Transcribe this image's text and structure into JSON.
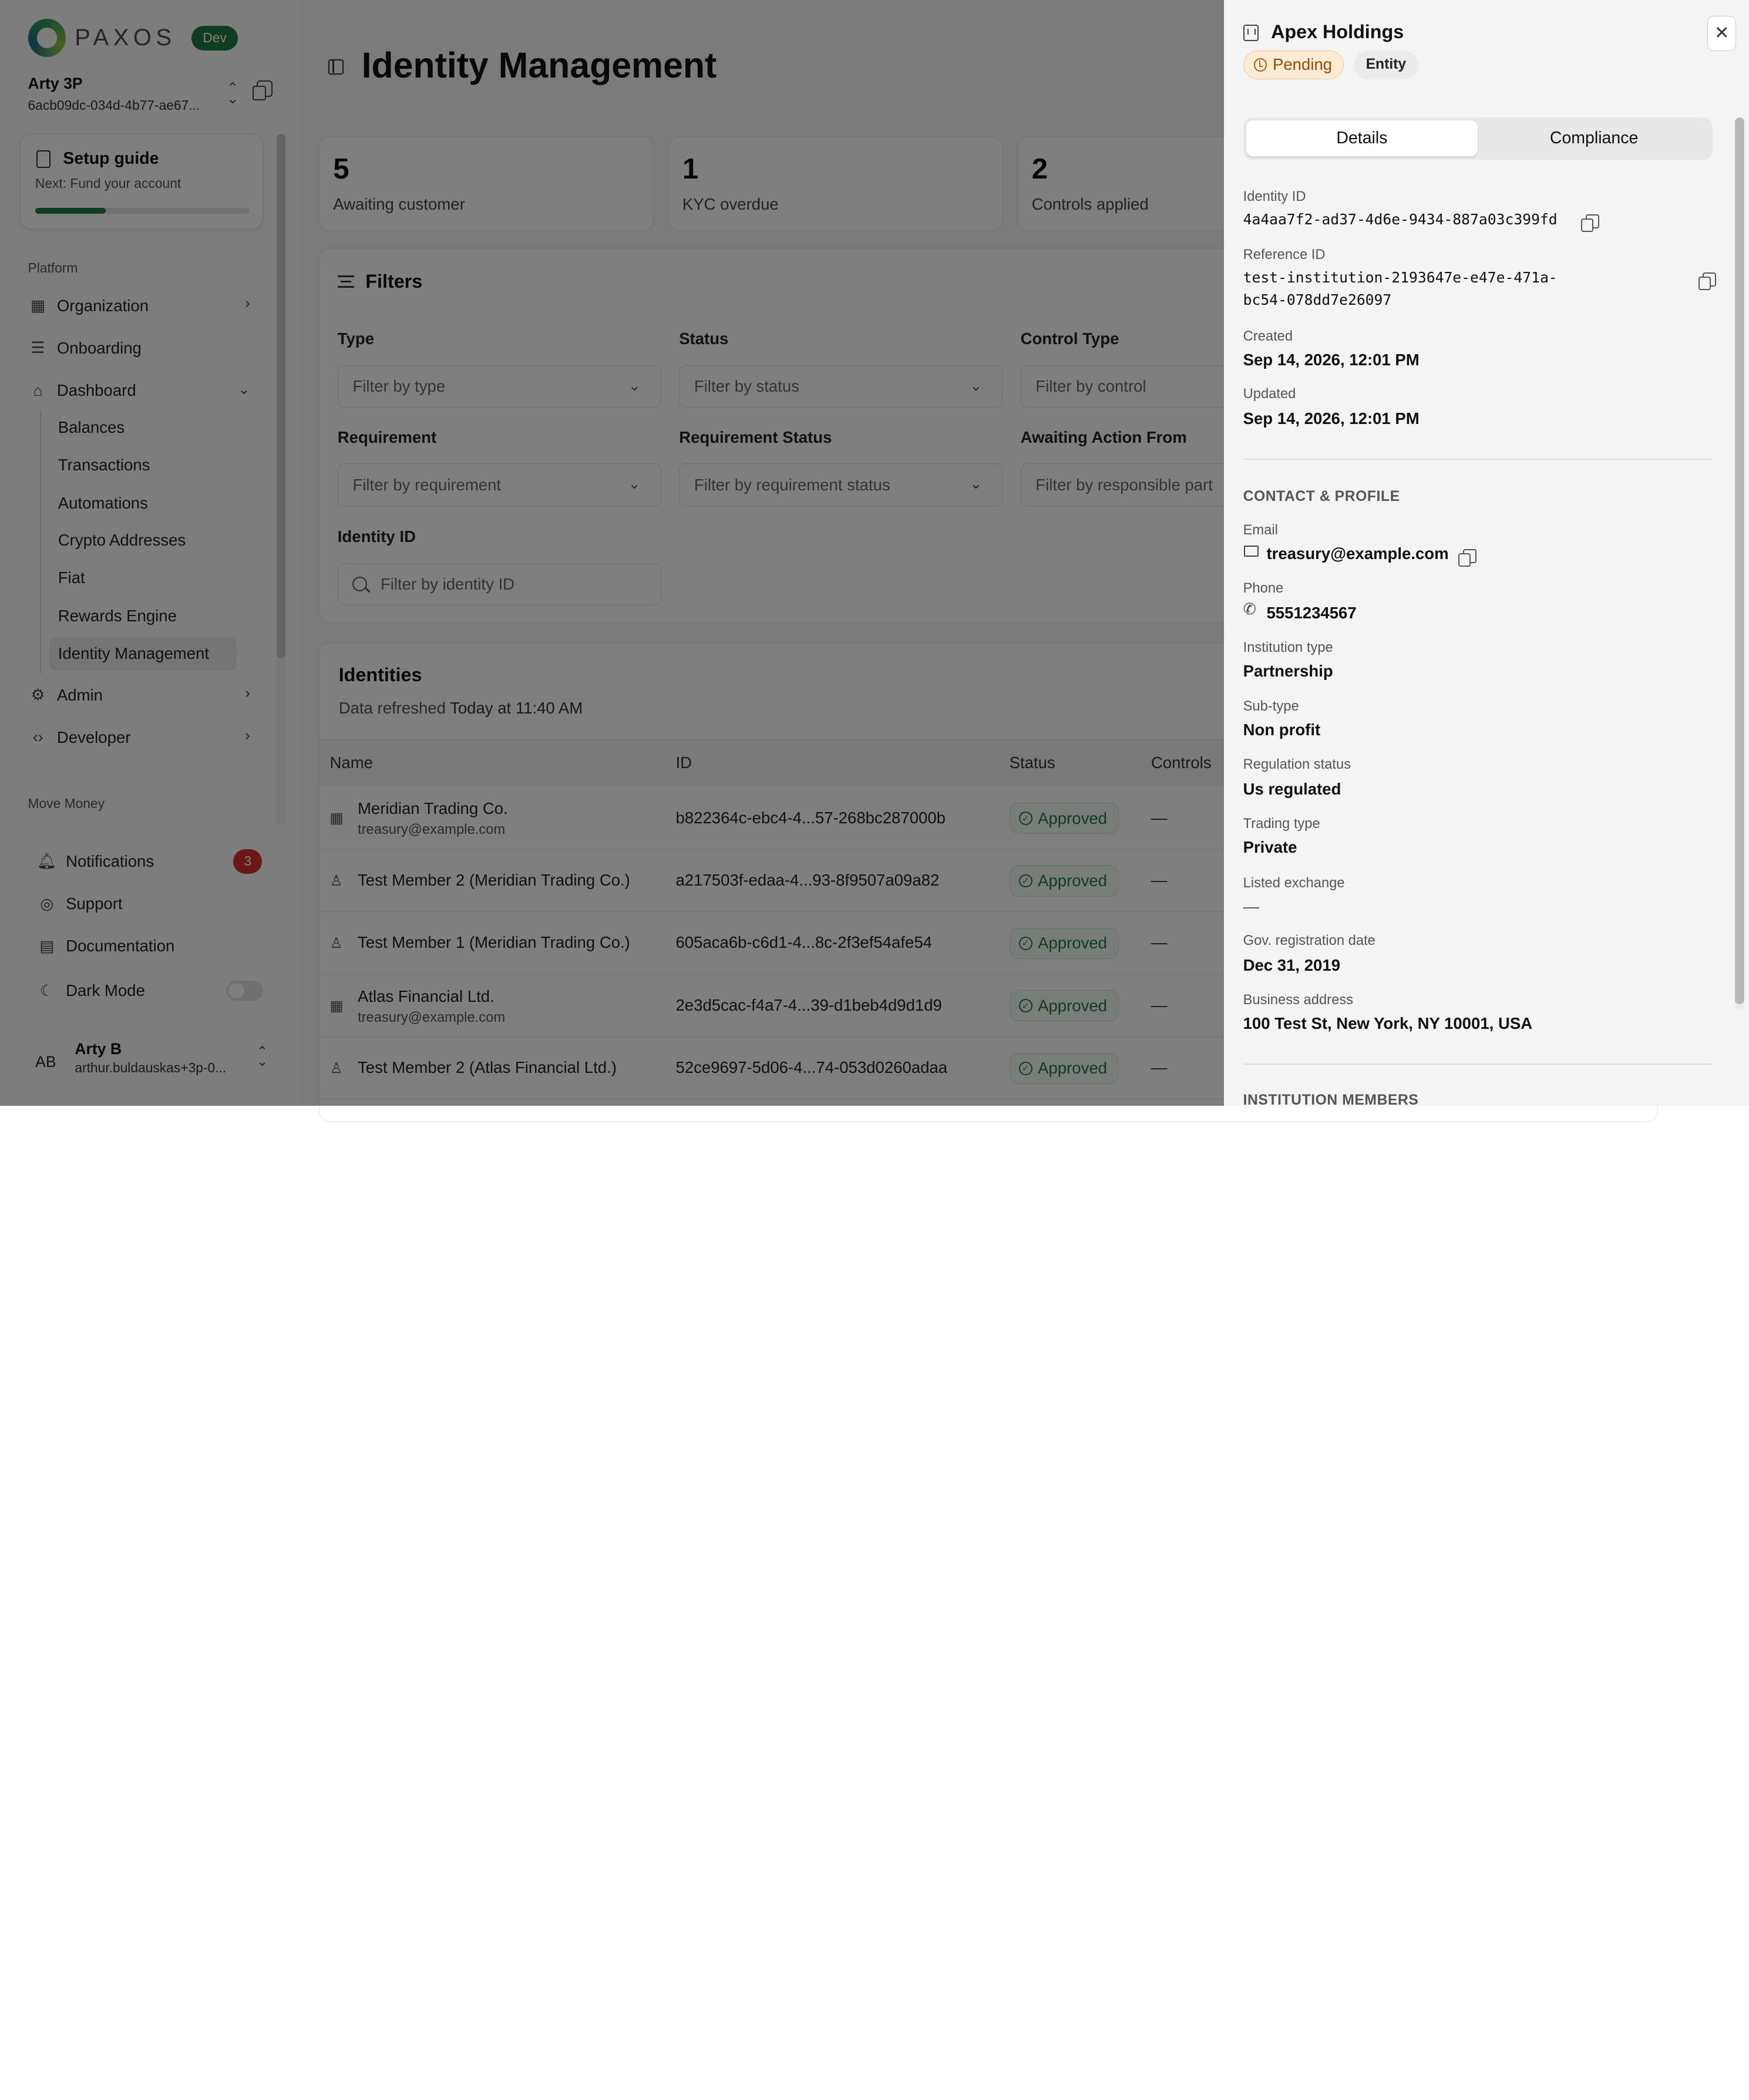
{
  "sidebar": {
    "logo_text": "PAXOS",
    "env_badge": "Dev",
    "account_name": "Arty 3P",
    "account_id": "6acb09dc-034d-4b77-ae67...",
    "setup": {
      "title": "Setup guide",
      "subtitle": "Next: Fund your account",
      "progress": 0.33
    },
    "platform_label": "Platform",
    "nav": {
      "organization": "Organization",
      "onboarding": "Onboarding",
      "dashboard": "Dashboard",
      "admin": "Admin",
      "developer": "Developer"
    },
    "dashboard_items": [
      "Balances",
      "Transactions",
      "Automations",
      "Crypto Addresses",
      "Fiat",
      "Rewards Engine",
      "Identity Management"
    ],
    "move_money_label": "Move Money",
    "notifications": "Notifications",
    "notifications_count": "3",
    "support": "Support",
    "documentation": "Documentation",
    "dark_mode": "Dark Mode",
    "user": {
      "initials": "AB",
      "name": "Arty B",
      "email": "arthur.buldauskas+3p-0..."
    }
  },
  "main": {
    "title": "Identity Management",
    "stats": [
      {
        "value": "5",
        "label": "Awaiting customer"
      },
      {
        "value": "1",
        "label": "KYC overdue"
      },
      {
        "value": "2",
        "label": "Controls applied"
      }
    ],
    "filters": {
      "title": "Filters",
      "type_label": "Type",
      "type_placeholder": "Filter by type",
      "status_label": "Status",
      "status_placeholder": "Filter by status",
      "control_label": "Control Type",
      "control_placeholder": "Filter by control",
      "requirement_label": "Requirement",
      "requirement_placeholder": "Filter by requirement",
      "req_status_label": "Requirement Status",
      "req_status_placeholder": "Filter by requirement status",
      "awaiting_label": "Awaiting Action From",
      "awaiting_placeholder": "Filter by responsible part",
      "identity_label": "Identity ID",
      "identity_placeholder": "Filter by identity ID"
    },
    "identities": {
      "title": "Identities",
      "refresh_prefix": "Data refreshed ",
      "refresh_time": "Today at 11:40 AM",
      "columns": {
        "name": "Name",
        "id": "ID",
        "status": "Status",
        "controls": "Controls"
      },
      "rows": [
        {
          "name": "Meridian Trading Co.",
          "email": "treasury@example.com",
          "id": "b822364c-ebc4-4...57-268bc287000b",
          "status": "Approved",
          "controls": "—",
          "kind": "entity"
        },
        {
          "name": "Test Member 2 (Meridian Trading Co.)",
          "email": "",
          "id": "a217503f-edaa-4...93-8f9507a09a82",
          "status": "Approved",
          "controls": "—",
          "kind": "person"
        },
        {
          "name": "Test Member 1 (Meridian Trading Co.)",
          "email": "",
          "id": "605aca6b-c6d1-4...8c-2f3ef54afe54",
          "status": "Approved",
          "controls": "—",
          "kind": "person"
        },
        {
          "name": "Atlas Financial Ltd.",
          "email": "treasury@example.com",
          "id": "2e3d5cac-f4a7-4...39-d1beb4d9d1d9",
          "status": "Approved",
          "controls": "—",
          "kind": "entity"
        },
        {
          "name": "Test Member 2 (Atlas Financial Ltd.)",
          "email": "",
          "id": "52ce9697-5d06-4...74-053d0260adaa",
          "status": "Approved",
          "controls": "—",
          "kind": "person"
        }
      ]
    }
  },
  "drawer": {
    "title": "Apex Holdings",
    "status": "Pending",
    "type_badge": "Entity",
    "tabs": {
      "details": "Details",
      "compliance": "Compliance"
    },
    "identity_id_label": "Identity ID",
    "identity_id": "4a4aa7f2-ad37-4d6e-9434-887a03c399fd",
    "reference_id_label": "Reference ID",
    "reference_id_line1": "test-institution-2193647e-e47e-471a-",
    "reference_id_line2": "bc54-078dd7e26097",
    "created_label": "Created",
    "created": "Sep 14, 2026, 12:01 PM",
    "updated_label": "Updated",
    "updated": "Sep 14, 2026, 12:01 PM",
    "contact_header": "CONTACT & PROFILE",
    "email_label": "Email",
    "email": "treasury@example.com",
    "phone_label": "Phone",
    "phone": "5551234567",
    "institution_type_label": "Institution type",
    "institution_type": "Partnership",
    "sub_type_label": "Sub-type",
    "sub_type": "Non profit",
    "regulation_label": "Regulation status",
    "regulation": "Us regulated",
    "trading_label": "Trading type",
    "trading": "Private",
    "listed_label": "Listed exchange",
    "listed": "—",
    "gov_date_label": "Gov. registration date",
    "gov_date": "Dec 31, 2019",
    "address_label": "Business address",
    "address": "100 Test St, New York, NY 10001, USA",
    "members_header": "INSTITUTION MEMBERS"
  },
  "colors": {
    "brand_green": "#1f7a3f",
    "pending_bg": "#fdebd5",
    "pending_text": "#9a4b00",
    "badge_red": "#d32f2f"
  }
}
